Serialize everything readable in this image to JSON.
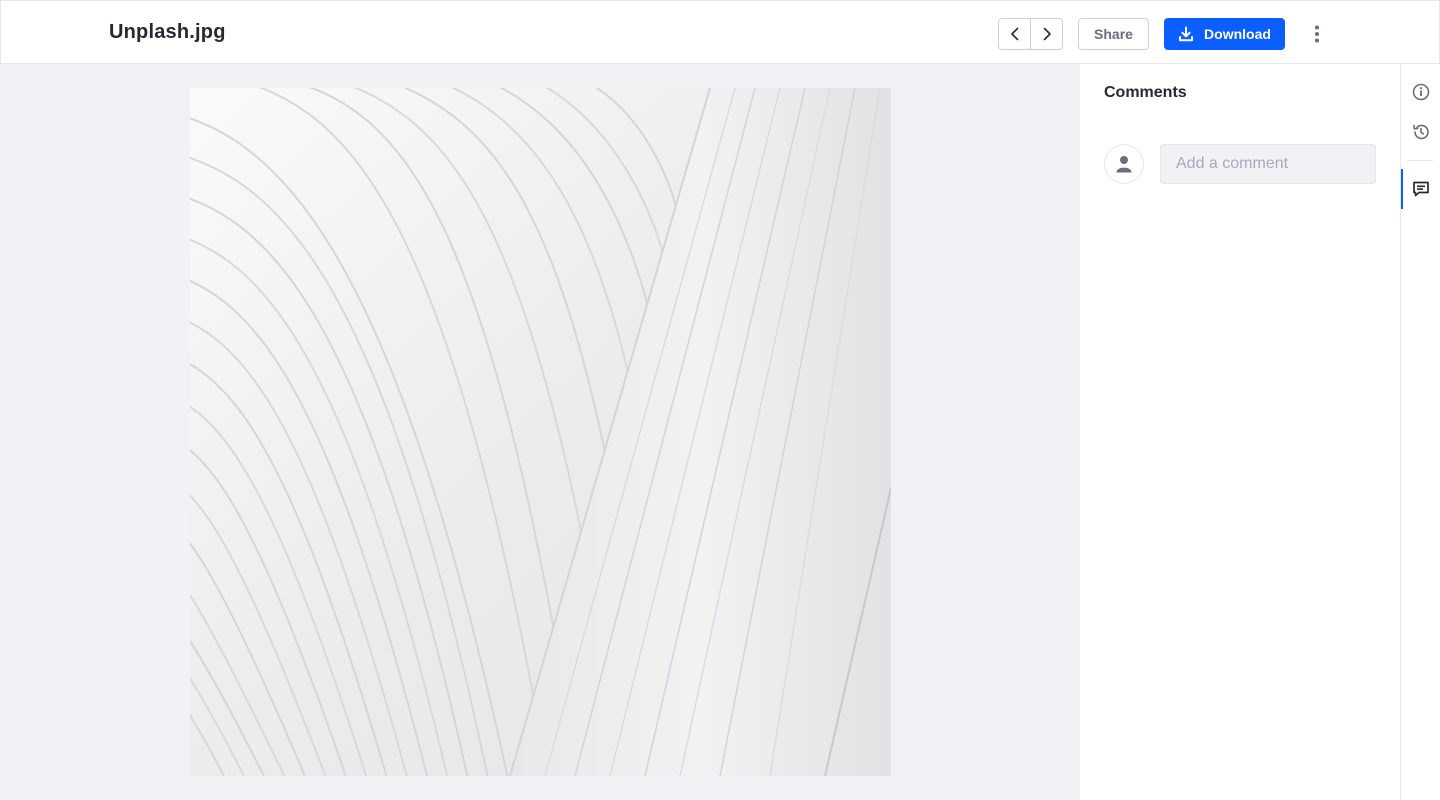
{
  "header": {
    "title": "Unplash.jpg",
    "share_label": "Share",
    "download_label": "Download",
    "icons": {
      "prev": "chevron-left-icon",
      "next": "chevron-right-icon",
      "download": "download-icon",
      "more": "ellipsis-vertical-icon"
    }
  },
  "preview": {
    "image_alt": "architectural white ribbed structure photo"
  },
  "comments": {
    "title": "Comments",
    "input_placeholder": "Add a comment",
    "avatar_icon": "user-icon"
  },
  "sidebar": {
    "items": [
      {
        "icon": "info-circle-icon",
        "active": false
      },
      {
        "icon": "history-icon",
        "active": false
      },
      {
        "icon": "comments-icon",
        "active": true
      }
    ]
  },
  "colors": {
    "accent": "#0b5fff",
    "background": "#f1f2f5",
    "border": "#cdced9",
    "text_primary": "#272833",
    "text_secondary": "#6b6c7e",
    "placeholder": "#a7a9bc"
  }
}
